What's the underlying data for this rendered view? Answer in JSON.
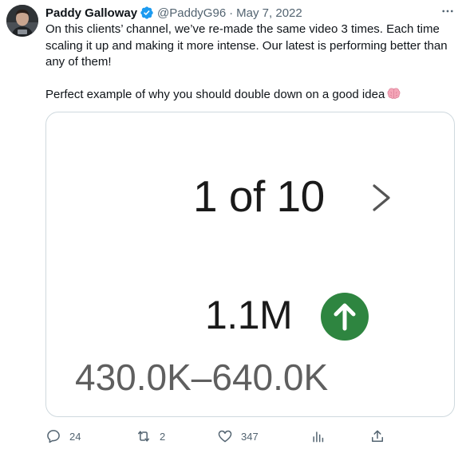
{
  "tweet": {
    "author_name": "Paddy Galloway",
    "handle": "@PaddyG96",
    "separator": "·",
    "date": "May 7, 2022",
    "paragraph_1": "On this clients’ channel, we’ve re-made the same video 3 times. Each time scaling it up and making it more intense. Our latest is performing better than any of them!",
    "paragraph_2": "Perfect example of why you should double down on a good idea"
  },
  "media": {
    "counter": "1 of 10",
    "views": "1.1M",
    "range": "430.0K–640.0K"
  },
  "actions": {
    "replies": "24",
    "retweets": "2",
    "likes": "347"
  },
  "colors": {
    "verified": "#1d9bf0",
    "up_badge": "#2e8540",
    "secondary_text": "#536471"
  },
  "icons": {
    "more": "more-icon",
    "reply": "reply-icon",
    "retweet": "retweet-icon",
    "like": "heart-icon",
    "analytics": "analytics-icon",
    "share": "share-icon"
  }
}
